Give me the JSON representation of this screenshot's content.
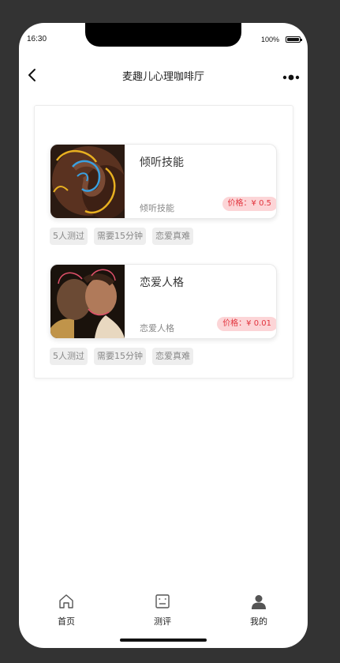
{
  "status_bar": {
    "time": "16:30",
    "battery": "100%"
  },
  "nav": {
    "title": "麦趣儿心理咖啡厅",
    "back_icon": "chevron-left-icon",
    "more_icon": "more-dots-icon"
  },
  "tests": [
    {
      "title": "倾听技能",
      "subtitle": "倾听技能",
      "price": "价格：¥ 0.5",
      "tags": [
        "5人测过",
        "需要15分钟",
        "恋爱真难"
      ],
      "thumbnail": "ear-illustration"
    },
    {
      "title": "恋爱人格",
      "subtitle": "恋爱人格",
      "price": "价格：¥ 0.01",
      "tags": [
        "5人测过",
        "需要15分钟",
        "恋爱真难"
      ],
      "thumbnail": "couple-illustration"
    }
  ],
  "tabbar": {
    "items": [
      {
        "label": "首页",
        "icon": "home-icon"
      },
      {
        "label": "测评",
        "icon": "assessment-icon"
      },
      {
        "label": "我的",
        "icon": "user-icon"
      }
    ]
  },
  "colors": {
    "price_bg": "#fcd5d7",
    "price_text": "#e2343d",
    "tag_bg": "#eeeeee",
    "frame_bg": "#333333"
  }
}
